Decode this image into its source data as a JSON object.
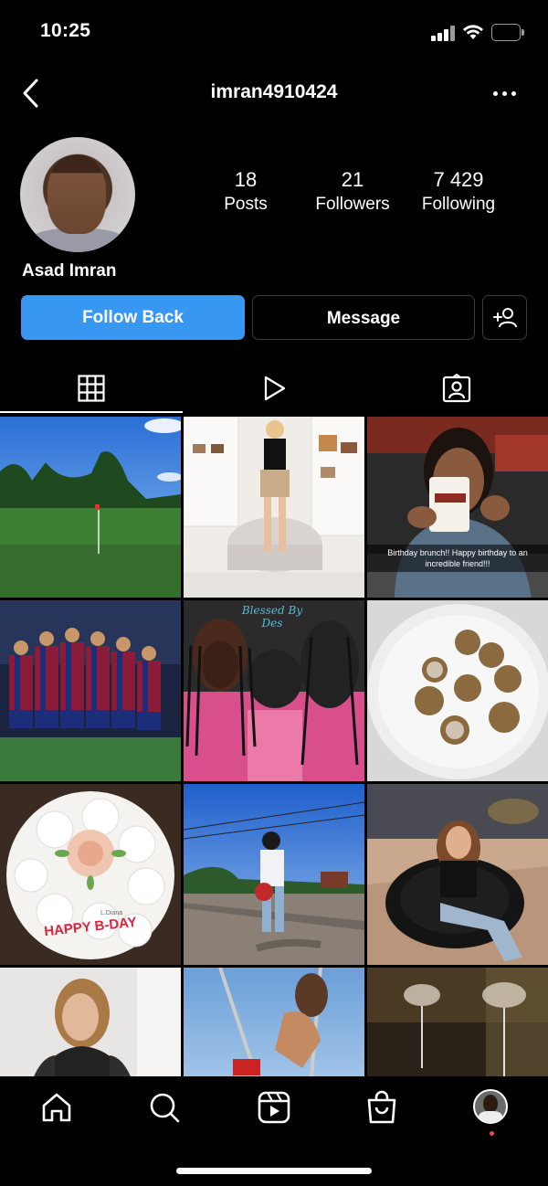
{
  "status_bar": {
    "time": "10:25"
  },
  "header": {
    "username": "imran4910424"
  },
  "profile": {
    "full_name": "Asad Imran",
    "stats": [
      {
        "value": "18",
        "label": "Posts"
      },
      {
        "value": "21",
        "label": "Followers"
      },
      {
        "value": "7 429",
        "label": "Following"
      }
    ]
  },
  "actions": {
    "follow_back_label": "Follow Back",
    "message_label": "Message"
  },
  "tabs": [
    {
      "icon": "grid-icon",
      "active": true
    },
    {
      "icon": "reels-play-icon",
      "active": false
    },
    {
      "icon": "tagged-person-icon",
      "active": false
    }
  ],
  "posts": [
    {
      "subject": "golf course"
    },
    {
      "subject": "woman in closet"
    },
    {
      "subject": "woman with mug",
      "caption": "Birthday brunch!! Happy birthday to an incredible friend!!!"
    },
    {
      "subject": "football team huddle"
    },
    {
      "subject": "braided hairstyles",
      "watermark": "Blessed By Des"
    },
    {
      "subject": "powdered truffles"
    },
    {
      "subject": "birthday cake",
      "cake_text": "HAPPY B-DAY",
      "cake_small_text": "L.Diana"
    },
    {
      "subject": "man on road with flowers"
    },
    {
      "subject": "girl in chair"
    },
    {
      "subject": "woman in fur jacket"
    },
    {
      "subject": "woman on swing"
    },
    {
      "subject": "wine glasses"
    }
  ],
  "bottom_nav": [
    {
      "icon": "home-icon"
    },
    {
      "icon": "search-icon"
    },
    {
      "icon": "reels-icon"
    },
    {
      "icon": "shop-bag-icon"
    },
    {
      "icon": "profile-avatar-icon"
    }
  ],
  "colors": {
    "follow_button": "#3897f0",
    "notification_dot": "#ed4956",
    "background": "#000000"
  }
}
